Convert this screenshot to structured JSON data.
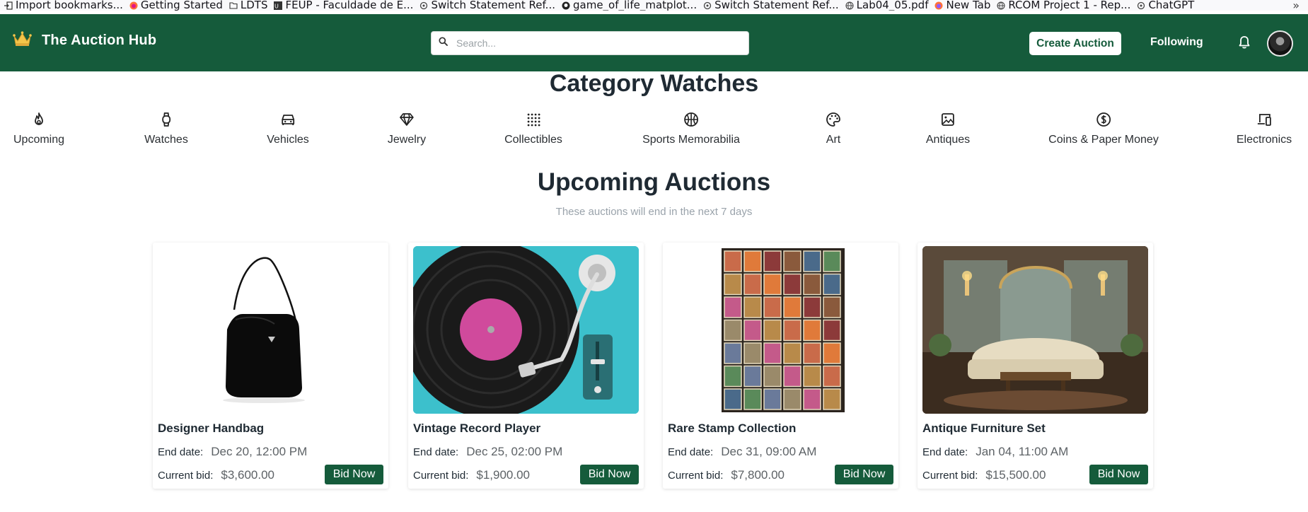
{
  "bookmarks": {
    "items": [
      {
        "label": "Import bookmarks...",
        "icon": "import-icon"
      },
      {
        "label": "Getting Started",
        "icon": "firefox-icon"
      },
      {
        "label": "LDTS",
        "icon": "folder-icon"
      },
      {
        "label": "FEUP - Faculdade de E...",
        "icon": "feup-icon"
      },
      {
        "label": "Switch Statement Ref...",
        "icon": "openai-icon"
      },
      {
        "label": "game_of_life_matplot...",
        "icon": "github-icon"
      },
      {
        "label": "Switch Statement Ref...",
        "icon": "openai-icon"
      },
      {
        "label": "Lab04_05.pdf",
        "icon": "globe-icon"
      },
      {
        "label": "New Tab",
        "icon": "firefox-icon"
      },
      {
        "label": "RCOM Project 1 - Rep...",
        "icon": "globe-icon"
      },
      {
        "label": "ChatGPT",
        "icon": "openai-icon"
      }
    ],
    "overflow": "»"
  },
  "header": {
    "brand": "The Auction Hub",
    "search_placeholder": "Search...",
    "create_label": "Create Auction",
    "following_label": "Following",
    "color": "#155b3b"
  },
  "category_title": "Category Watches",
  "categories": [
    {
      "label": "Upcoming",
      "icon": "flame-icon"
    },
    {
      "label": "Watches",
      "icon": "watch-icon"
    },
    {
      "label": "Vehicles",
      "icon": "car-icon"
    },
    {
      "label": "Jewelry",
      "icon": "diamond-icon"
    },
    {
      "label": "Collectibles",
      "icon": "grid-icon"
    },
    {
      "label": "Sports Memorabilia",
      "icon": "basketball-icon"
    },
    {
      "label": "Art",
      "icon": "palette-icon"
    },
    {
      "label": "Antiques",
      "icon": "picture-icon"
    },
    {
      "label": "Coins & Paper Money",
      "icon": "dollar-coin-icon"
    },
    {
      "label": "Electronics",
      "icon": "devices-icon"
    }
  ],
  "upcoming": {
    "title": "Upcoming Auctions",
    "subtitle": "These auctions will end in the next 7 days"
  },
  "cards": [
    {
      "name": "Designer Handbag",
      "end_label": "End date:",
      "end": "Dec 20, 12:00 PM",
      "bid_label": "Current bid:",
      "bid": "$3,600.00",
      "button": "Bid Now"
    },
    {
      "name": "Vintage Record Player",
      "end_label": "End date:",
      "end": "Dec 25, 02:00 PM",
      "bid_label": "Current bid:",
      "bid": "$1,900.00",
      "button": "Bid Now"
    },
    {
      "name": "Rare Stamp Collection",
      "end_label": "End date:",
      "end": "Dec 31, 09:00 AM",
      "bid_label": "Current bid:",
      "bid": "$7,800.00",
      "button": "Bid Now"
    },
    {
      "name": "Antique Furniture Set",
      "end_label": "End date:",
      "end": "Jan 04, 11:00 AM",
      "bid_label": "Current bid:",
      "bid": "$15,500.00",
      "button": "Bid Now"
    }
  ]
}
